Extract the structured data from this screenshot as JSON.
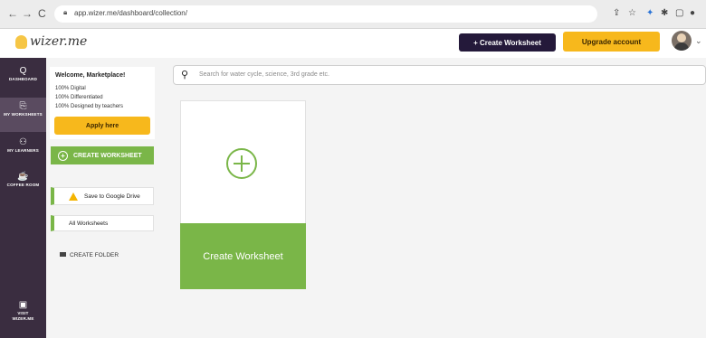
{
  "browser": {
    "url": "app.wizer.me/dashboard/collection/",
    "back": "←",
    "forward": "→",
    "reload": "C"
  },
  "header": {
    "logo_text": "wizer.me",
    "create_button": "+ Create Worksheet",
    "upgrade_button": "Upgrade account",
    "caret": "⌄"
  },
  "icon_bar": {
    "items": [
      {
        "glyph": "Q",
        "label": "DASHBOARD"
      },
      {
        "glyph": "⎘",
        "label": "MY WORKSHEETS"
      },
      {
        "glyph": "⚇",
        "label": "MY LEARNERS"
      },
      {
        "glyph": "☕",
        "label": "COFFEE ROOM"
      },
      {
        "glyph": "▣",
        "label": "VISIT WIZER.ME"
      }
    ]
  },
  "side_panel": {
    "welcome_title": "Welcome, Marketplace!",
    "lines": [
      "100% Digital",
      "100% Differentiated",
      "100% Designed by teachers"
    ],
    "apply_button": "Apply here",
    "create_worksheet": "CREATE WORKSHEET",
    "save_drive": "Save to Google Drive",
    "all_worksheets": "All Worksheets",
    "create_folder": "CREATE FOLDER"
  },
  "main": {
    "search_placeholder": "Search for water cycle, science, 3rd grade etc.",
    "card_label": "Create Worksheet"
  },
  "colors": {
    "accent_green": "#7ab648",
    "brand_dark": "#24193a",
    "upgrade_yellow": "#f7b81c",
    "sidebar": "#3a2d40"
  }
}
